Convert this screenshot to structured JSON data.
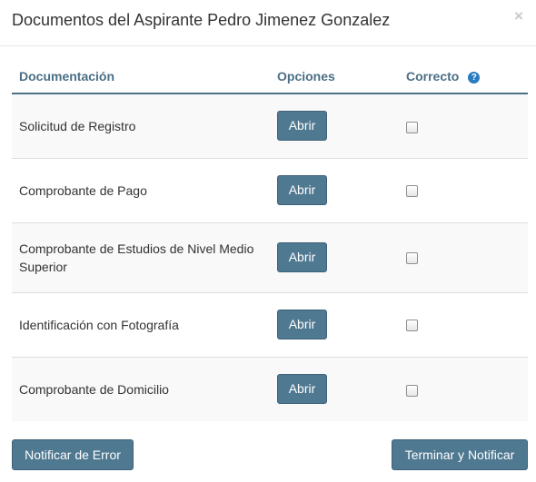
{
  "modal": {
    "title": "Documentos del Aspirante Pedro Jimenez Gonzalez",
    "close_label": "×"
  },
  "table": {
    "headers": {
      "documentacion": "Documentación",
      "opciones": "Opciones",
      "correcto": "Correcto"
    },
    "help_icon": "question-circle-icon",
    "rows": [
      {
        "document": "Solicitud de Registro",
        "action_label": "Abrir",
        "checked": false
      },
      {
        "document": "Comprobante de Pago",
        "action_label": "Abrir",
        "checked": false
      },
      {
        "document": "Comprobante de Estudios de Nivel Medio Superior",
        "action_label": "Abrir",
        "checked": false
      },
      {
        "document": "Identificación con Fotografía",
        "action_label": "Abrir",
        "checked": false
      },
      {
        "document": "Comprobante de Domicilio",
        "action_label": "Abrir",
        "checked": false
      }
    ]
  },
  "footer": {
    "notify_error_label": "Notificar de Error",
    "finish_notify_label": "Terminar y Notificar"
  },
  "colors": {
    "button": "#4f7891",
    "header_text": "#4b6f86",
    "help_icon": "#2b7bc0"
  }
}
